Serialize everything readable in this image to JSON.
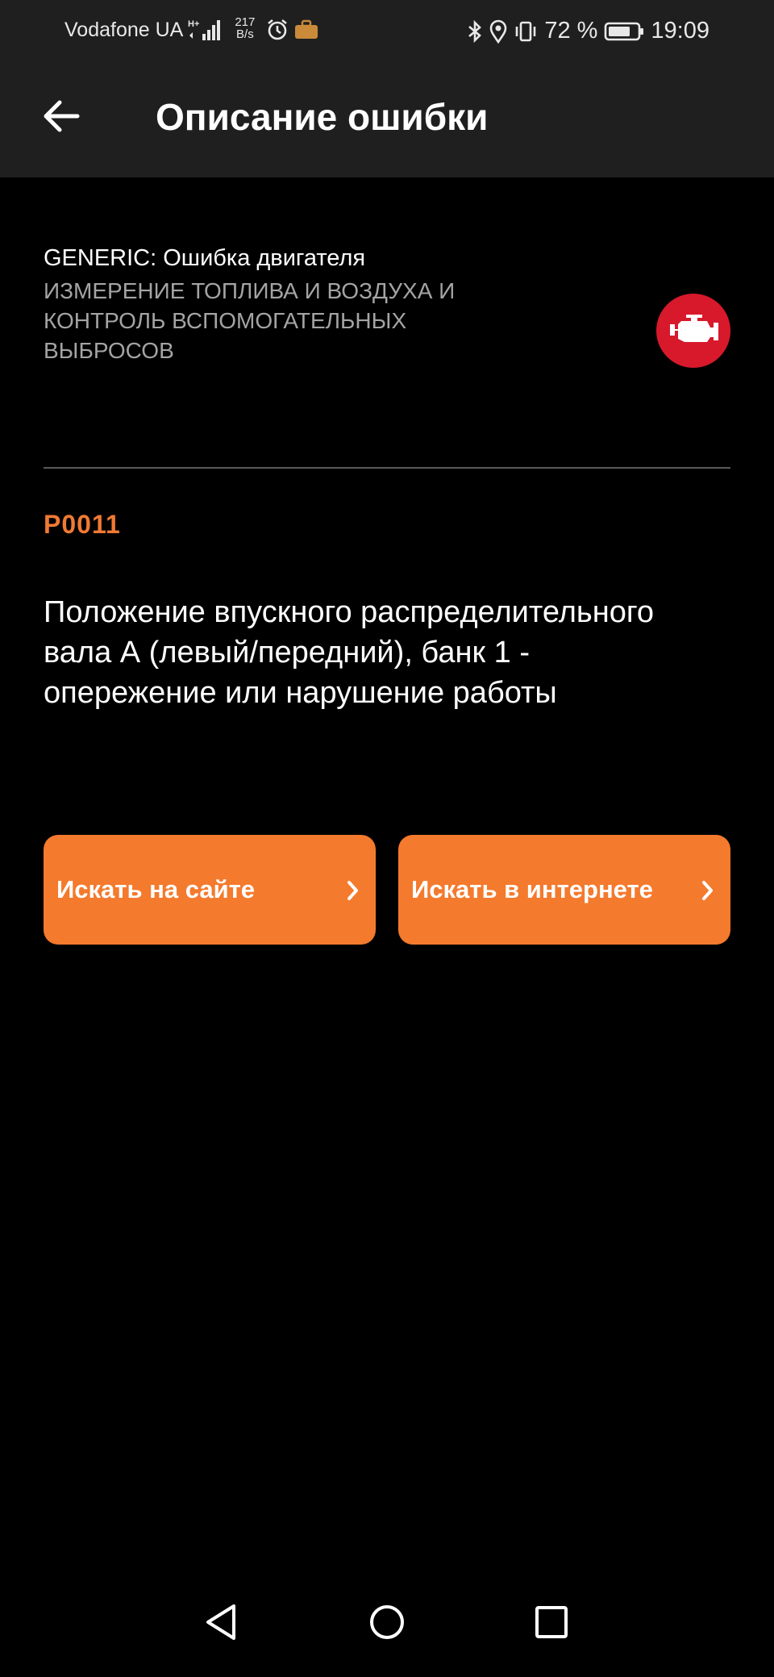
{
  "status_bar": {
    "carrier": "Vodafone UA",
    "network_type": "H+",
    "net_speed_value": "217",
    "net_speed_unit": "B/s",
    "battery_percent": "72 %",
    "time": "19:09"
  },
  "app_bar": {
    "title": "Описание ошибки"
  },
  "error": {
    "category_main": "GENERIC: Ошибка двигателя",
    "category_sub": "ИЗМЕРЕНИЕ ТОПЛИВА И ВОЗДУХА И КОНТРОЛЬ ВСПОМОГАТЕЛЬНЫХ ВЫБРОСОВ",
    "code": "P0011",
    "description": "Положение впускного распределительного вала А (левый/передний), банк 1 - опережение или нарушение работы"
  },
  "buttons": {
    "search_site_label": "Искать на сайте",
    "search_web_label": "Искать в интернете"
  },
  "colors": {
    "accent": "#f47a2d",
    "code_text": "#f07a33",
    "engine_badge": "#d7192b",
    "bar_background": "#1f1f1f",
    "page_background": "#000000"
  }
}
